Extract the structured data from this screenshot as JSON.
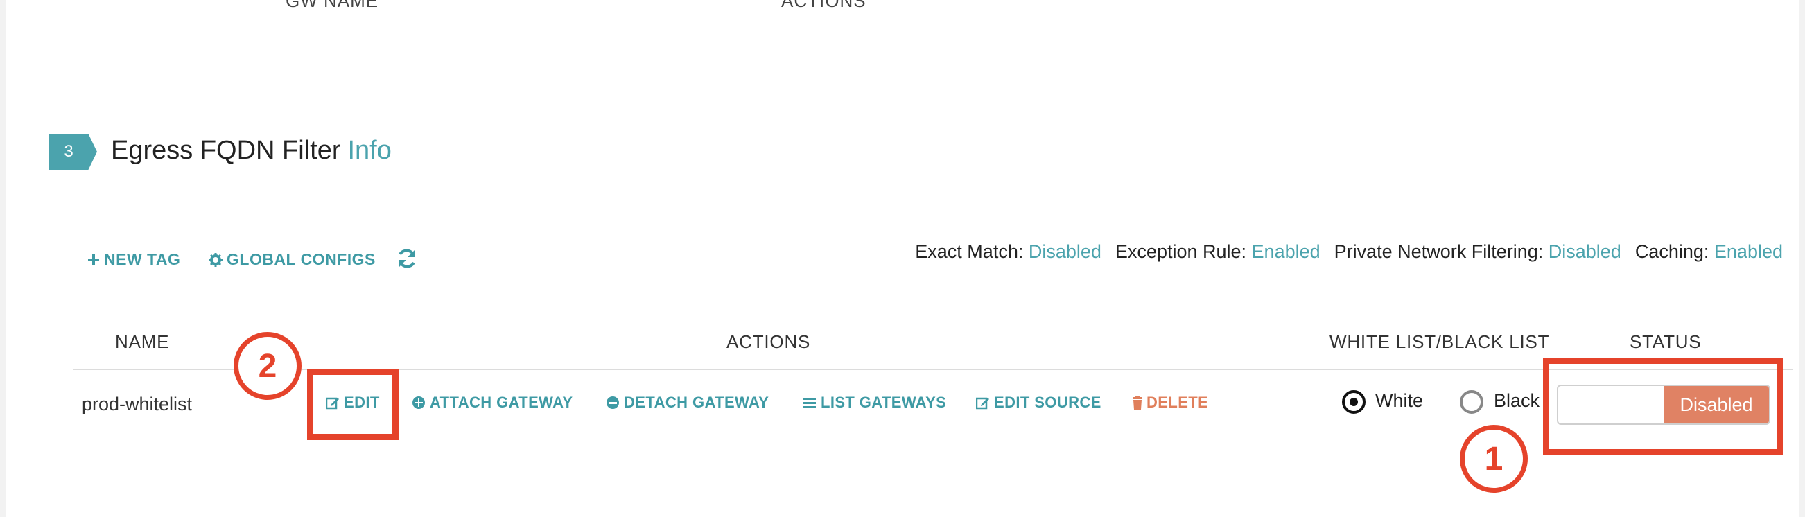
{
  "previous_table": {
    "col1": "GW NAME",
    "col2": "ACTIONS"
  },
  "section": {
    "step": "3",
    "title": "Egress FQDN Filter",
    "info_link": "Info"
  },
  "toolbar": {
    "new_tag": "NEW TAG",
    "global_configs": "GLOBAL CONFIGS"
  },
  "settings": [
    {
      "label": "Exact Match:",
      "value": "Disabled"
    },
    {
      "label": "Exception Rule:",
      "value": "Enabled"
    },
    {
      "label": "Private Network Filtering:",
      "value": "Disabled"
    },
    {
      "label": "Caching:",
      "value": "Enabled"
    }
  ],
  "table": {
    "headers": {
      "name": "NAME",
      "actions": "ACTIONS",
      "list_type": "WHITE LIST/BLACK LIST",
      "status": "STATUS"
    },
    "rows": [
      {
        "name": "prod-whitelist",
        "actions": {
          "edit": "EDIT",
          "attach": "ATTACH GATEWAY",
          "detach": "DETACH GATEWAY",
          "list": "LIST GATEWAYS",
          "edit_source": "EDIT SOURCE",
          "delete": "DELETE"
        },
        "white_label": "White",
        "black_label": "Black",
        "status": "Disabled"
      }
    ]
  },
  "annotations": {
    "marker1": "1",
    "marker2": "2"
  },
  "colors": {
    "accent": "#4ba3ad",
    "danger": "#e07f5b",
    "annotation": "#e5432b"
  }
}
